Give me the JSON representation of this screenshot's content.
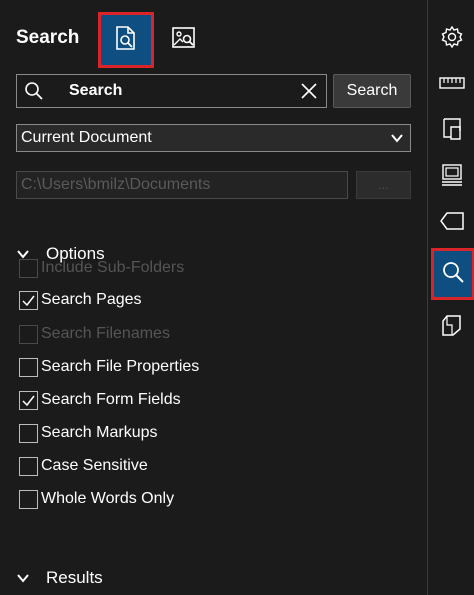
{
  "header": {
    "title": "Search",
    "mode_buttons": [
      {
        "name": "document-search-icon",
        "active": true
      },
      {
        "name": "image-search-icon",
        "active": false
      }
    ]
  },
  "search": {
    "value": "Search",
    "button_label": "Search"
  },
  "scope": {
    "selected": "Current Document"
  },
  "path": {
    "value": "C:\\Users\\bmilz\\Documents",
    "browse_label": "..."
  },
  "options_section": {
    "label": "Options",
    "items": [
      {
        "label": "Include Sub-Folders",
        "checked": false,
        "disabled": true
      },
      {
        "label": "Search Pages",
        "checked": true,
        "disabled": false
      },
      {
        "label": "Search Filenames",
        "checked": false,
        "disabled": true
      },
      {
        "label": "Search File Properties",
        "checked": false,
        "disabled": false
      },
      {
        "label": "Search Form Fields",
        "checked": true,
        "disabled": false
      },
      {
        "label": "Search Markups",
        "checked": false,
        "disabled": false
      },
      {
        "label": "Case Sensitive",
        "checked": false,
        "disabled": false
      },
      {
        "label": "Whole Words Only",
        "checked": false,
        "disabled": false
      }
    ]
  },
  "results_section": {
    "label": "Results"
  },
  "rail": {
    "items": [
      {
        "icon": "gear-icon",
        "active": false
      },
      {
        "icon": "ruler-icon",
        "active": false
      },
      {
        "icon": "pages-icon",
        "active": false
      },
      {
        "icon": "stamp-icon",
        "active": false
      },
      {
        "icon": "tag-icon",
        "active": false
      },
      {
        "icon": "search-icon",
        "active": true
      },
      {
        "icon": "shape-icon",
        "active": false
      }
    ]
  },
  "colors": {
    "background": "#1b1b1b",
    "accent": "#0f4e80",
    "highlight": "#d9252a",
    "disabled_text": "#555555"
  }
}
